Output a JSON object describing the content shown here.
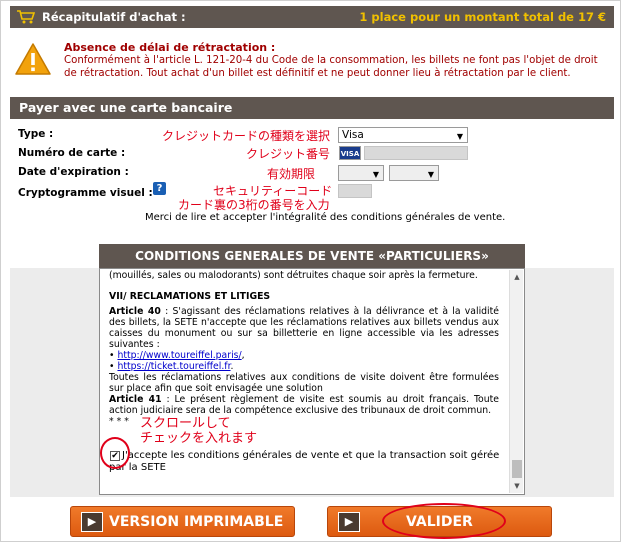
{
  "summary": {
    "title": "Récapitulatif d'achat :",
    "total": "1 place pour un montant total de 17 €"
  },
  "warning": {
    "title": "Absence de délai de rétractation :",
    "text": "Conformément à l'article L. 121-20-4 du Code de la consommation, les billets ne font pas l'objet de droit de rétractation. Tout achat d'un billet est définitif et ne peut donner lieu à rétractation par le client."
  },
  "payment": {
    "title": "Payer avec une carte bancaire",
    "type_label": "Type :",
    "type_value": "Visa",
    "card_label": "Numéro de carte :",
    "expiry_label": "Date d'expiration :",
    "cvv_label": "Cryptogramme visuel :",
    "visa_badge": "VISA",
    "help_glyph": "?",
    "notes": {
      "type": "クレジットカードの種類を選択",
      "card": "クレジット番号",
      "expiry": "有効期限",
      "cvv_line1": "セキュリティーコード",
      "cvv_line2": "カード裏の3桁の番号を入力"
    },
    "merci": "Merci de lire et accepter l'intégralité des conditions générales de vente."
  },
  "cgv": {
    "title": "CONDITIONS GENERALES DE VENTE «PARTICULIERS»",
    "line_top": "(mouillés, sales ou malodorants) sont détruites chaque soir après la fermeture.",
    "section": "VII/ RECLAMATIONS ET LITIGES",
    "art40_label": "Article 40",
    "art40_text": " : S'agissant des réclamations relatives à la délivrance et à la validité des billets, la SETE n'accepte que les réclamations relatives aux billets vendus aux caisses du monument ou sur sa billetterie en ligne accessible via les adresses suivantes :",
    "link1": "http://www.toureiffel.paris/",
    "link2": "https://ticket.toureiffel.fr",
    "reclam_text": "Toutes les réclamations relatives aux conditions de visite doivent être formulées sur place afin que soit envisagée une solution",
    "art41_label": "Article 41",
    "art41_text": " : Le présent règlement de visite est soumis au droit français. Toute action judiciaire sera de la compétence exclusive des tribunaux de droit commun.",
    "stars": "* * *",
    "scroll_note_line1": "スクロールして",
    "scroll_note_line2": "チェックを入れます",
    "accept_text": "J'accepte les conditions générales de vente et que la transaction soit gérée par la SETE",
    "checkbox_mark": "✔"
  },
  "buttons": {
    "print": "VERSION IMPRIMABLE",
    "validate": "VALIDER"
  },
  "colors": {
    "bar": "#5f5650",
    "accent_yellow": "#f0c000",
    "warning_red": "#a00000",
    "note_red": "#e0001a",
    "button_orange": "#e8661c"
  }
}
